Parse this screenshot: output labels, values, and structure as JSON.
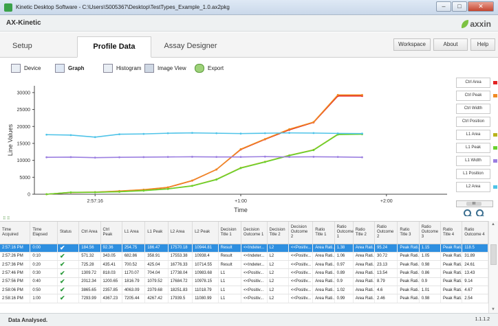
{
  "window": {
    "title": "Kinetic Desktop Software - C:\\Users\\S005367\\Desktop\\TestTypes_Example_1.0.ax2pkg",
    "minimize": "–",
    "maximize": "□",
    "close": "✕"
  },
  "brand": {
    "app_name": "AX-Kinetic",
    "logo_text": "axxin"
  },
  "tabs": [
    {
      "label": "Setup"
    },
    {
      "label": "Profile Data"
    },
    {
      "label": "Assay Designer"
    }
  ],
  "top_buttons": {
    "workspace": "Workspace",
    "about": "About",
    "help": "Help"
  },
  "toolbar": [
    {
      "label": "Device",
      "icon": "device-icon"
    },
    {
      "label": "Graph",
      "icon": "graph-icon"
    },
    {
      "label": "Histogram",
      "icon": "histogram-icon"
    },
    {
      "label": "Image View",
      "icon": "image-view-icon"
    },
    {
      "label": "Export",
      "icon": "export-icon"
    }
  ],
  "chart_data": {
    "type": "line",
    "xlabel": "Time",
    "ylabel": "Line Values",
    "ylim": [
      0,
      32000
    ],
    "yticks": [
      0,
      5000,
      10000,
      15000,
      20000,
      25000,
      30000
    ],
    "x_tick_labels": [
      {
        "label": "2:57:16",
        "x": 0
      },
      {
        "label": "+1:00",
        "x": 60
      },
      {
        "label": "+2:00",
        "x": 120
      }
    ],
    "xlim": [
      -25,
      145
    ],
    "x": [
      -20,
      -10,
      0,
      10,
      20,
      30,
      40,
      50,
      60,
      70,
      80,
      90,
      100,
      110,
      120
    ],
    "series": [
      {
        "name": "Ctrl Area",
        "color": "#e32222",
        "values": [
          0,
          500,
          600,
          900,
          1300,
          2000,
          4000,
          7300,
          13200,
          16200,
          19000,
          21200,
          29000,
          29000,
          null
        ]
      },
      {
        "name": "Ctrl Peak",
        "color": "#f08a24",
        "values": [
          0,
          520,
          630,
          950,
          1350,
          2050,
          4050,
          7300,
          13300,
          16300,
          19200,
          21300,
          29300,
          29300,
          null
        ]
      },
      {
        "name": "L1 Area",
        "color": "#b9b41b",
        "values": [
          0,
          560,
          580,
          750,
          1100,
          1600,
          2500,
          4400,
          7800,
          9600,
          11500,
          13100,
          17700,
          17800,
          null
        ]
      },
      {
        "name": "L1 Peak",
        "color": "#6ad12e",
        "values": [
          0,
          540,
          560,
          720,
          1050,
          1550,
          2450,
          4300,
          7700,
          9500,
          11400,
          13000,
          17600,
          17700,
          null
        ]
      },
      {
        "name": "L1 Width",
        "color": "#9b7ee0",
        "values": [
          10900,
          10950,
          10800,
          10900,
          10950,
          11000,
          11050,
          11000,
          11000,
          11100,
          11000,
          11050,
          11000,
          10900,
          null
        ]
      },
      {
        "name": "L2 Area",
        "color": "#4ec3e8",
        "values": [
          17570,
          17450,
          16850,
          17700,
          17800,
          18000,
          18100,
          18000,
          17900,
          18000,
          18100,
          18050,
          17950,
          17900,
          null
        ]
      }
    ],
    "legend": [
      "Ctrl Area",
      "Ctrl Peak",
      "Ctrl Width",
      "Ctrl Position",
      "L1 Area",
      "L1 Peak",
      "L1 Width",
      "L1 Position",
      "L2 Area"
    ],
    "legend_colors": [
      "#e32222",
      "#f08a24",
      "",
      "",
      "#b9b41b",
      "#6ad12e",
      "#9b7ee0",
      "",
      "#4ec3e8"
    ],
    "legend_placement": "right",
    "grid": false
  },
  "scroll_h_label": "III",
  "divider_grip": "⠿ ⠿",
  "table": {
    "headers": [
      "Time Acquired",
      "Time Elapsed",
      "Status",
      "Ctrl Area",
      "Ctrl Peak",
      "L1 Area",
      "L1 Peak",
      "L2 Area",
      "L2 Peak",
      "Decision Title 1",
      "Decision Outcome 1",
      "Decision Title 2",
      "Decision Outcome 2",
      "Ratio Title 1",
      "Ratio Outcome 1",
      "Ratio Title 2",
      "Ratio Outcome 2",
      "Ratio Title 3",
      "Ratio Outcome 3",
      "Ratio Title 4",
      "Ratio Outcome 4"
    ],
    "rows": [
      [
        "2:57:16 PM",
        "0:00",
        "✔",
        "184.56",
        "92.36",
        "254.75",
        "186.47",
        "17570.18",
        "10944.81",
        "Result",
        "<<Indeter...",
        "L2",
        "<<Positiv...",
        "Area Rati...",
        "1.38",
        "Area Rati...",
        "95.24",
        "Peak Rati...",
        "1.15",
        "Peak Rati...",
        "118.5"
      ],
      [
        "2:57:26 PM",
        "0:10",
        "✔",
        "571.32",
        "343.05",
        "682.86",
        "358.91",
        "17553.38",
        "10938.4",
        "Result",
        "<<Indeter...",
        "L2",
        "<<Positiv...",
        "Area Rati...",
        "1.06",
        "Area Rati...",
        "30.72",
        "Peak Rati...",
        "1.05",
        "Peak Rati...",
        "31.89"
      ],
      [
        "2:57:36 PM",
        "0:20",
        "✔",
        "725.28",
        "435.41",
        "700.52",
        "425.04",
        "16776.33",
        "10714.55",
        "Result",
        "<<Indeter...",
        "L2",
        "<<Positiv...",
        "Area Rati...",
        "0.97",
        "Area Rati...",
        "23.13",
        "Peak Rati...",
        "0.98",
        "Peak Rati...",
        "24.61"
      ],
      [
        "2:57:46 PM",
        "0:30",
        "✔",
        "1309.72",
        "818.03",
        "1170.07",
        "704.04",
        "17738.04",
        "10983.68",
        "L1",
        "<<Positiv...",
        "L2",
        "<<Positiv...",
        "Area Rati...",
        "0.89",
        "Area Rati...",
        "13.54",
        "Peak Rati...",
        "0.86",
        "Peak Rati...",
        "13.43"
      ],
      [
        "2:57:56 PM",
        "0:40",
        "✔",
        "2012.34",
        "1200.65",
        "1816.79",
        "1079.52",
        "17684.72",
        "10978.15",
        "L1",
        "<<Positiv...",
        "L2",
        "<<Positiv...",
        "Area Rati...",
        "0.9",
        "Area Rati...",
        "8.79",
        "Peak Rati...",
        "0.9",
        "Peak Rati...",
        "9.14"
      ],
      [
        "2:58:06 PM",
        "0:50",
        "✔",
        "3865.65",
        "2357.85",
        "4063.09",
        "2379.68",
        "18251.83",
        "11018.79",
        "L1",
        "<<Positiv...",
        "L2",
        "<<Positiv...",
        "Area Rati...",
        "1.02",
        "Area Rati...",
        "4.6",
        "Peak Rati...",
        "1.01",
        "Peak Rati...",
        "4.67"
      ],
      [
        "2:58:16 PM",
        "1:00",
        "✔",
        "7293.99",
        "4367.23",
        "7205.44",
        "4267.42",
        "17939.5",
        "11080.99",
        "L1",
        "<<Positiv...",
        "L2",
        "<<Positiv...",
        "Area Rati...",
        "0.99",
        "Area Rati...",
        "2.46",
        "Peak Rati...",
        "0.98",
        "Peak Rati...",
        "2.54"
      ]
    ],
    "selected_row": 0
  },
  "status": {
    "message": "Data Analysed.",
    "version": "1.1.1.2"
  }
}
